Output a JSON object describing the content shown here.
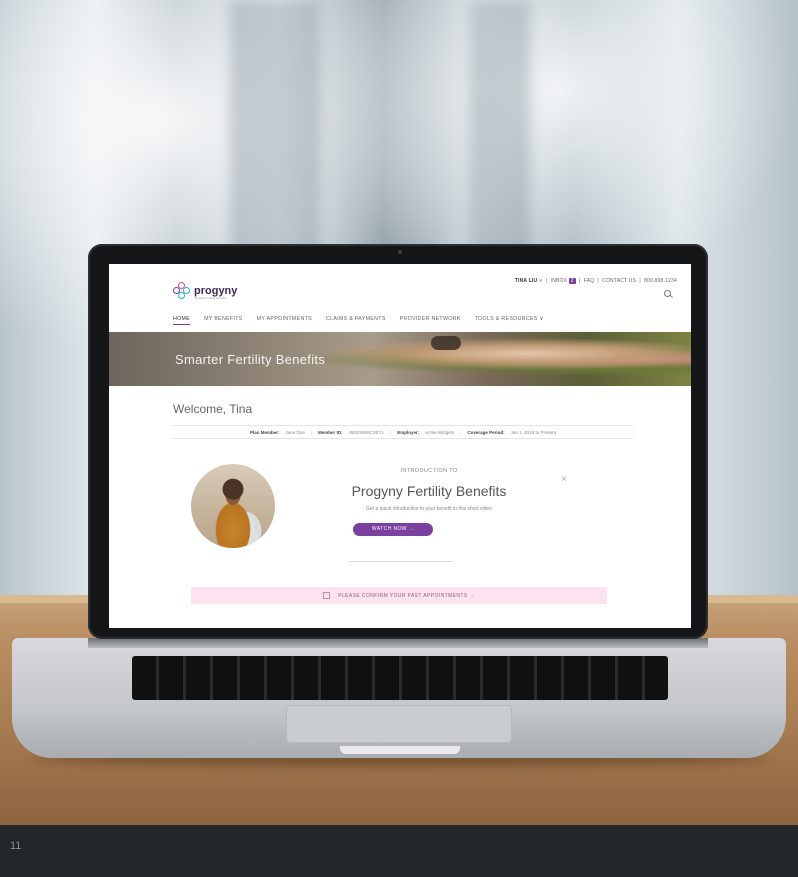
{
  "page_number": "11",
  "screen": {
    "brand": {
      "name": "progyny",
      "tagline": "Smarter fertility benefits"
    },
    "utility": {
      "user": "TINA LIU",
      "user_caret": "∨",
      "inbox_label": "INBOX",
      "inbox_count": "2",
      "faq": "FAQ",
      "contact": "CONTACT US",
      "phone": "800.898.1234"
    },
    "nav": {
      "home": "HOME",
      "my_benefits": "MY BENEFITS",
      "my_appointments": "MY APPOINTMENTS",
      "claims_payments": "CLAIMS & PAYMENTS",
      "provider_network": "PROVIDER NETWORK",
      "tools_resources": "TOOLS & RESOURCES"
    },
    "hero": {
      "title": "Smarter Fertility Benefits"
    },
    "welcome": "Welcome, Tina",
    "member": {
      "plan_member_label": "Plan Member:",
      "plan_member_value": "Jane Doe",
      "member_id_label": "Member ID:",
      "member_id_value": "4502000MC3EY1",
      "employer_label": "Employer:",
      "employer_value": "Acme Widgets",
      "coverage_label": "Coverage Period:",
      "coverage_value": "Jan 1, 2018 to Present"
    },
    "intro": {
      "label": "INTRODUCTION TO",
      "title": "Progyny Fertility Benefits",
      "description": "Get a quick introduction to your benefit in this short video",
      "watch_button": "WATCH NOW →"
    },
    "confirm": {
      "label": "PLEASE CONFIRM YOUR PAST APPOINTMENTS  →"
    }
  },
  "colors": {
    "accent": "#7b3fa0",
    "confirm_bg": "#fce3ef"
  }
}
